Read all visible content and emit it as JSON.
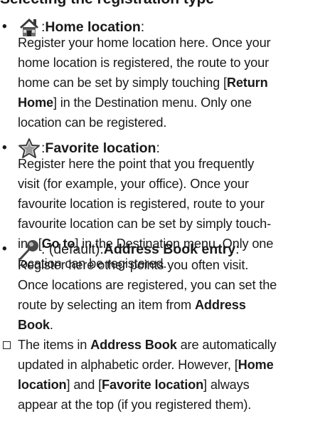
{
  "section_heading_cutoff": "Selecting the registration type",
  "items": [
    {
      "bullet": "•",
      "icon": "home-icon",
      "lead_sep": ": ",
      "title": "Home location",
      "title_suffix": ":",
      "lines": [
        [
          "Register your home location here. Once your"
        ],
        [
          "home location is registered, the route to your"
        ],
        [
          "home can be set by simply touching [",
          {
            "b": "Return"
          }
        ],
        [
          {
            "b": "Home"
          },
          "] in the Destination menu. Only one"
        ],
        [
          "location can be registered."
        ]
      ]
    },
    {
      "bullet": "•",
      "icon": "star-icon",
      "lead_sep": ": ",
      "title": "Favorite location",
      "title_suffix": ":",
      "lines": [
        [
          "Register here the point that you frequently"
        ],
        [
          "visit (for example, your office). Once your"
        ],
        [
          "favourite location is registered, route to your"
        ],
        [
          "favourite location can be set by simply touch-"
        ],
        [
          "ing [",
          {
            "b": "Go to"
          },
          "] in the Destination menu. Only one"
        ],
        [
          "location can be registered."
        ]
      ]
    },
    {
      "bullet": "•",
      "icon": "pin-icon",
      "lead_sep": ": (default): ",
      "title": "Address Book entry",
      "title_suffix": ":",
      "lines": [
        [
          "Register here other points you often visit."
        ],
        [
          "Once locations are registered, you can set the"
        ],
        [
          "route by selecting an item from ",
          {
            "b": "Address"
          }
        ],
        [
          {
            "b": "Book"
          },
          "."
        ]
      ]
    }
  ],
  "note": {
    "lines": [
      [
        "The items in ",
        {
          "b": "Address Book"
        },
        " are automatically"
      ],
      [
        "updated in alphabetic order. However, [",
        {
          "b": "Home"
        }
      ],
      [
        {
          "b": "location"
        },
        "] and [",
        {
          "b": "Favorite location"
        },
        "] always"
      ],
      [
        "appear at the top (if you registered them)."
      ]
    ]
  }
}
